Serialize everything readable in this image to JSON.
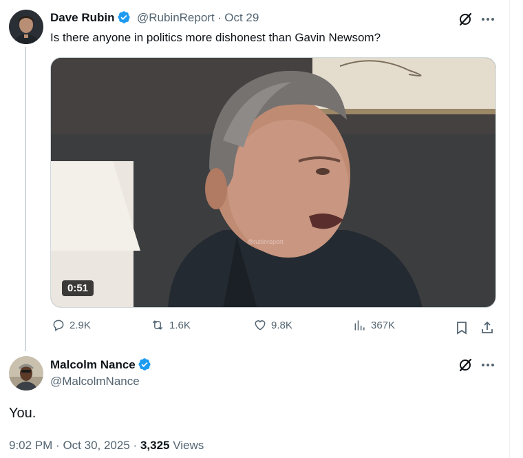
{
  "original_tweet": {
    "author_name": "Dave Rubin",
    "handle": "@RubinReport",
    "date": "Oct 29",
    "separator": "·",
    "text": "Is there anyone in politics more dishonest than Gavin Newsom?",
    "media": {
      "duration": "0:51",
      "watermark": "@rubinreport"
    },
    "actions": {
      "replies": "2.9K",
      "reposts": "1.6K",
      "likes": "9.8K",
      "views": "367K"
    }
  },
  "reply": {
    "author_name": "Malcolm Nance",
    "handle": "@MalcolmNance",
    "text": "You.",
    "time": "9:02 PM",
    "date": "Oct 30, 2025",
    "separator": "·",
    "views_count": "3,325",
    "views_label": "Views"
  },
  "colors": {
    "verified": "#1d9bf0",
    "text_secondary": "#536471",
    "thread_line": "#cfd9de"
  },
  "icons": [
    "verified-badge-icon",
    "grok-icon",
    "more-icon",
    "reply-icon",
    "repost-icon",
    "like-icon",
    "views-icon",
    "bookmark-icon",
    "share-icon"
  ]
}
